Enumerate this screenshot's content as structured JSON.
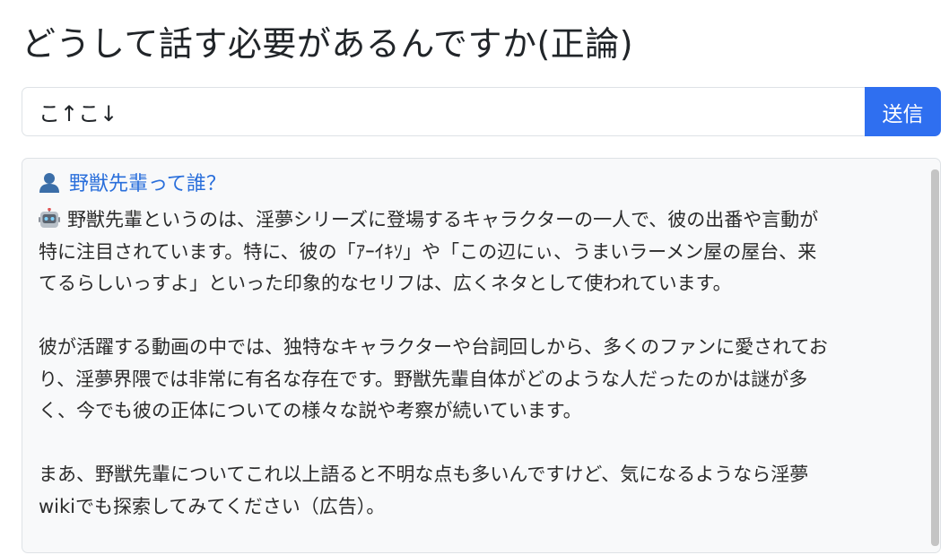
{
  "page": {
    "title": "どうして話す必要があるんですか(正論)"
  },
  "input": {
    "value": "こ↑こ↓"
  },
  "send_button": {
    "label": "送信"
  },
  "chat": {
    "user_message": "野獣先輩って誰？",
    "bot_message": "野獣先輩というのは、淫夢シリーズに登場するキャラクターの一人で、彼の出番や言動が\n特に注目されています。特に、彼の「ｱｰｲｷｿ」や「この辺にぃ、うまいラーメン屋の屋台、来\nてるらしいっすよ」といった印象的なセリフは、広くネタとして使われています。\n\n彼が活躍する動画の中では、独特なキャラクターや台詞回しから、多くのファンに愛されてお\nり、淫夢界隈では非常に有名な存在です。野獣先輩自体がどのような人だったのかは謎が多\nく、今でも彼の正体についての様々な説や考察が続いています。\n\nまあ、野獣先輩についてこれ以上語ると不明な点も多いんですけど、気になるようなら淫夢\nwikiでも探索してみてください（広告）。"
  },
  "icons": {
    "user": "user-icon",
    "bot": "robot-icon"
  },
  "colors": {
    "accent": "#2f6ff0",
    "user_text": "#2a6fdb",
    "panel_bg": "#f8f9fa"
  }
}
